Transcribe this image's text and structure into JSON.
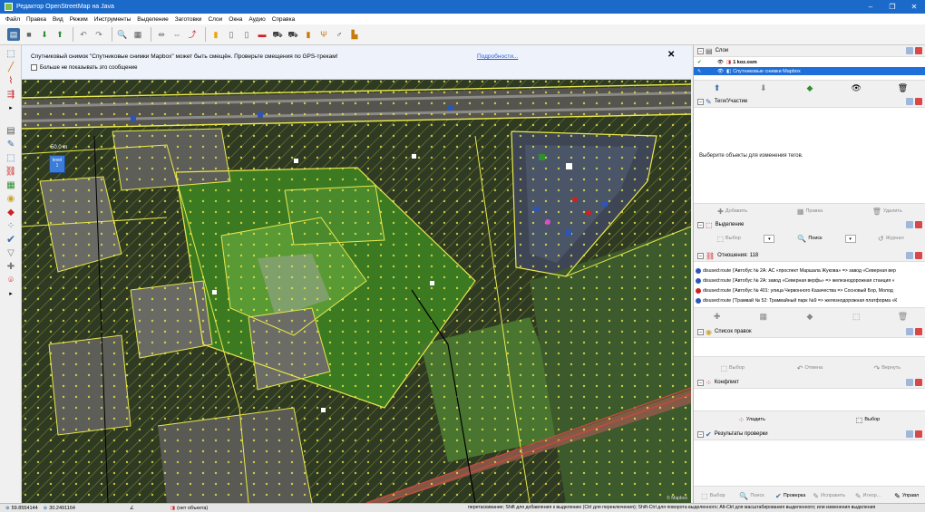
{
  "window": {
    "title": "Редактор OpenStreetMap на Java",
    "controls": [
      "–",
      "❐",
      "✕"
    ]
  },
  "menu": [
    "Файл",
    "Правка",
    "Вид",
    "Режим",
    "Инструменты",
    "Выделение",
    "Заготовки",
    "Слои",
    "Окна",
    "Аудио",
    "Справка"
  ],
  "notification": {
    "message": "Спутниковый снимок \"Спутниковые снимки Mapbox\" может быть смещён. Проверьте смещения по GPS-трекам!",
    "checkbox_label": "Больше не показывать это сообщение",
    "link": "Подробности...",
    "close": "✕"
  },
  "map": {
    "scale_label": "50.0 m",
    "level_label": "level",
    "level_value": "1",
    "copyright": "© Mapbox"
  },
  "panels": {
    "layers": {
      "title": "Слои",
      "items": [
        {
          "name": "1 koz.osm",
          "selected": false
        },
        {
          "name": "Спутниковые снимки Mapbox",
          "selected": true
        }
      ]
    },
    "tags": {
      "title": "Теги/Участие",
      "hint": "Выберите объекты для изменения тегов.",
      "buttons": [
        "Добавить",
        "Правка",
        "Удалить"
      ]
    },
    "selection": {
      "title": "Выделение",
      "buttons": [
        "Выбор",
        "Поиск",
        "Журнал"
      ]
    },
    "relations": {
      "title": "Отношения: 118",
      "items": [
        "disused:route ('Автобус № 2А: АС «проспект Маршала Жукова» => завод «Северная вер",
        "disused:route ('Автобус № 2А: завод «Северная верфь» => железнодорожная станция «",
        "disused:route ('Автобус № 401: улица Червонного Казачества => Сосновый Бор, Молод",
        "disused:route ('Трамвай № 52: Трамвайный парк №9 => железнодорожная платформа «К"
      ]
    },
    "changesets": {
      "title": "Список правок",
      "buttons": [
        "Выбор",
        "Отмена",
        "Вернуть"
      ]
    },
    "conflict": {
      "title": "Конфликт",
      "buttons": [
        "Уладить",
        "Выбор"
      ]
    },
    "validation": {
      "title": "Результаты проверки",
      "buttons": [
        "Выбор",
        "Поиск",
        "Проверка",
        "Исправить",
        "Игнор...",
        "Управл"
      ]
    }
  },
  "status": {
    "lat": "59.8554144",
    "lon": "30.2491164",
    "object": "(нет объекта)",
    "hint": "перетаскивание; Shift для добавления к выделению (Ctrl для переключения); Shift-Ctrl для поворота выделенного; Alt-Ctrl для масштабирования выделенного; или изменения выделения"
  },
  "colors": {
    "titlebar": "#1b6ac9",
    "selection": "#1e6fd9",
    "map_green": "#4f8a2a",
    "osm_yellow": "#e8e84a"
  }
}
